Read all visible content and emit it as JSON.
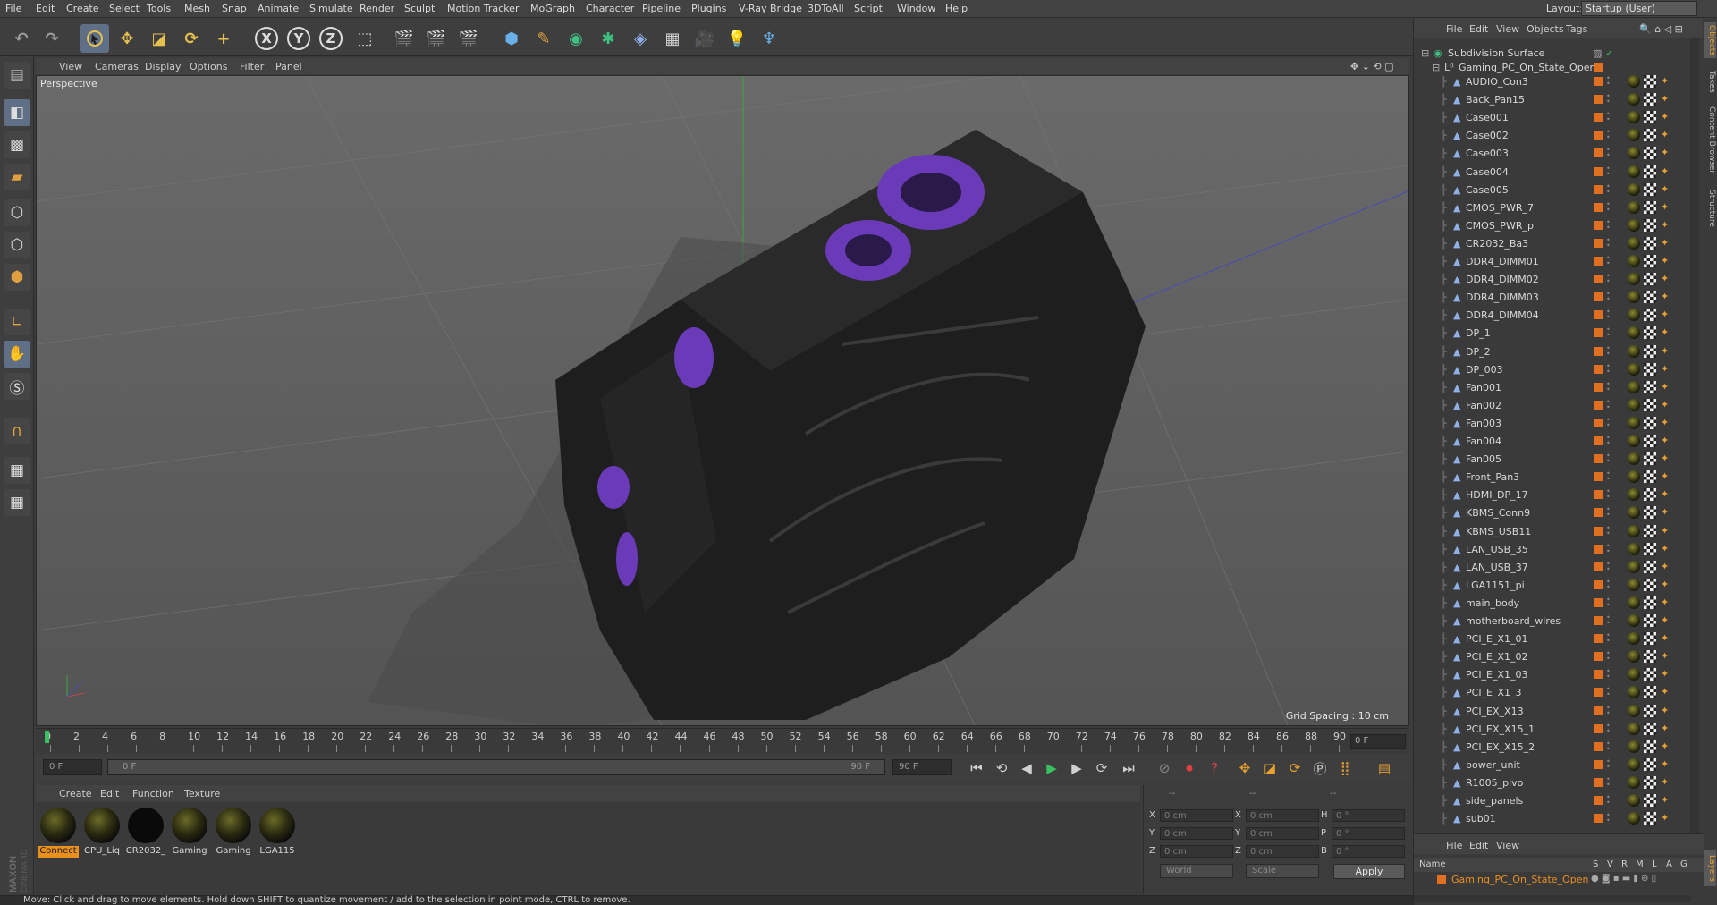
{
  "menu": [
    "File",
    "Edit",
    "Create",
    "Select",
    "Tools",
    "Mesh",
    "Snap",
    "Animate",
    "Simulate",
    "Render",
    "Sculpt",
    "Motion Tracker",
    "MoGraph",
    "Character",
    "Pipeline",
    "Plugins",
    "V-Ray Bridge",
    "3DToAll",
    "Script",
    "Window",
    "Help"
  ],
  "layout": {
    "label": "Layout:",
    "value": "Startup (User)"
  },
  "toolbar": {
    "x_axis": "X",
    "y_axis": "Y",
    "z_axis": "Z"
  },
  "viewport": {
    "menu": [
      "View",
      "Cameras",
      "Display",
      "Options",
      "Filter",
      "Panel"
    ],
    "title": "Perspective",
    "grid_spacing": "Grid Spacing : 10 cm"
  },
  "timeline": {
    "ticks": [
      "0",
      "2",
      "4",
      "6",
      "8",
      "10",
      "12",
      "14",
      "16",
      "18",
      "20",
      "22",
      "24",
      "26",
      "28",
      "30",
      "32",
      "34",
      "36",
      "38",
      "40",
      "42",
      "44",
      "46",
      "48",
      "50",
      "52",
      "54",
      "56",
      "58",
      "60",
      "62",
      "64",
      "66",
      "68",
      "70",
      "72",
      "74",
      "76",
      "78",
      "80",
      "82",
      "84",
      "86",
      "88",
      "90"
    ],
    "frame_display": "0 F"
  },
  "controls": {
    "start_frame": "0 F",
    "range_start": "0 F",
    "range_end": "90 F",
    "end_frame": "90 F"
  },
  "materials": {
    "menu": [
      "Create",
      "Edit",
      "Function",
      "Texture"
    ],
    "items": [
      "Connect",
      "CPU_Liq",
      "CR2032_",
      "Gaming",
      "Gaming",
      "LGA115"
    ]
  },
  "coords": {
    "header1": "--",
    "header2": "--",
    "header3": "--",
    "x": "X",
    "y": "Y",
    "z": "Z",
    "x2": "X",
    "y2": "Y",
    "z2": "Z",
    "h": "H",
    "p": "P",
    "b": "B",
    "x_val": "0 cm",
    "y_val": "0 cm",
    "z_val": "0 cm",
    "x2_val": "0 cm",
    "y2_val": "0 cm",
    "z2_val": "0 cm",
    "h_val": "0 °",
    "p_val": "0 °",
    "b_val": "0 °",
    "mode": "World",
    "scale": "Scale",
    "apply": "Apply"
  },
  "status": "Move: Click and drag to move elements. Hold down SHIFT to quantize movement / add to the selection in point mode, CTRL to remove.",
  "object_manager": {
    "menu": [
      "File",
      "Edit",
      "View",
      "Objects",
      "Tags"
    ],
    "root": "Subdivision Surface",
    "group": "Gaming_PC_On_State_Open",
    "objects": [
      "AUDIO_Con3",
      "Back_Pan15",
      "Case001",
      "Case002",
      "Case003",
      "Case004",
      "Case005",
      "CMOS_PWR_7",
      "CMOS_PWR_p",
      "CR2032_Ba3",
      "DDR4_DIMM01",
      "DDR4_DIMM02",
      "DDR4_DIMM03",
      "DDR4_DIMM04",
      "DP_1",
      "DP_2",
      "DP_003",
      "Fan001",
      "Fan002",
      "Fan003",
      "Fan004",
      "Fan005",
      "Front_Pan3",
      "HDMI_DP_17",
      "KBMS_Conn9",
      "KBMS_USB11",
      "LAN_USB_35",
      "LAN_USB_37",
      "LGA1151_pi",
      "main_body",
      "motherboard_wires",
      "PCI_E_X1_01",
      "PCI_E_X1_02",
      "PCI_E_X1_03",
      "PCI_E_X1_3",
      "PCI_EX_X13",
      "PCI_EX_X15_1",
      "PCI_EX_X15_2",
      "power_unit",
      "R1005_pivo",
      "side_panels",
      "sub01"
    ]
  },
  "right_tabs": [
    "Objects",
    "Takes",
    "Content Browser",
    "Structure",
    "Layers"
  ],
  "layer_manager": {
    "menu": [
      "File",
      "Edit",
      "View"
    ],
    "columns": [
      "Name",
      "S",
      "V",
      "R",
      "M",
      "L",
      "A",
      "G"
    ],
    "row": "Gaming_PC_On_State_Open"
  },
  "colors": {
    "accent": "#e89020",
    "selected_tool": "#5e6f86"
  }
}
